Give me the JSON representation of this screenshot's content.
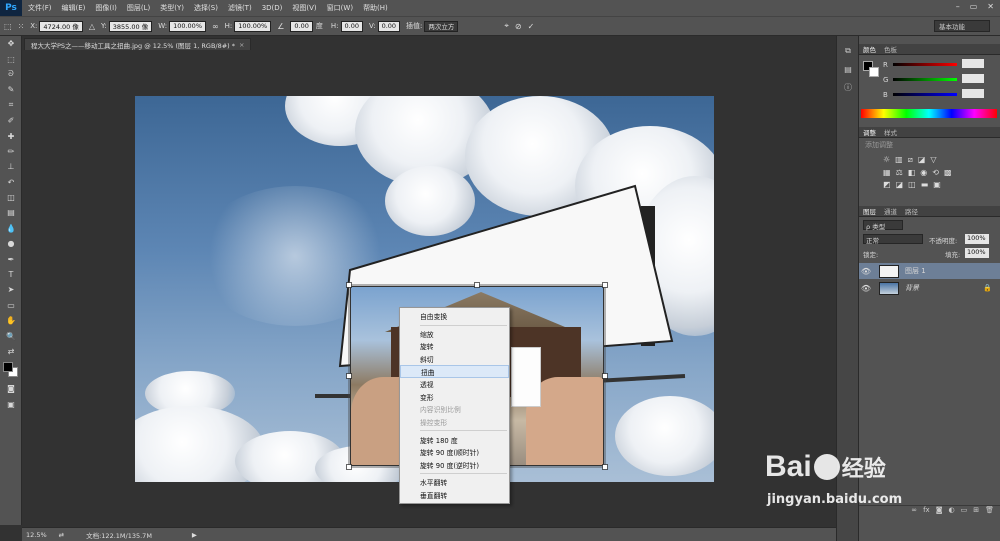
{
  "app": {
    "logo": "Ps"
  },
  "menus": [
    "文件(F)",
    "编辑(E)",
    "图像(I)",
    "图层(L)",
    "类型(Y)",
    "选择(S)",
    "滤镜(T)",
    "3D(D)",
    "视图(V)",
    "窗口(W)",
    "帮助(H)"
  ],
  "window_controls": {
    "minimize": "–",
    "restore": "▭",
    "close": "✕"
  },
  "options": {
    "x_label": "X:",
    "x_value": "4724.00 像",
    "y_label": "Y:",
    "y_value": "3855.00 像",
    "w_label": "W:",
    "w_value": "100.00%",
    "h_label": "H:",
    "h_value": "100.00%",
    "angle_value": "0.00",
    "angle_unit": "度",
    "hskew_label": "H:",
    "hskew_value": "0.00",
    "vskew_label": "V:",
    "vskew_value": "0.00",
    "interp_label": "插值:",
    "interp_value": "两次立方",
    "workspace": "基本功能"
  },
  "document_tab": {
    "title": "程大大学PS之——移动工具之扭曲.jpg @ 12.5% (图层 1, RGB/8#) *",
    "close": "×"
  },
  "context_menu": {
    "items": [
      {
        "label": "自由变换",
        "disabled": false
      },
      {
        "label": "缩放",
        "disabled": false
      },
      {
        "label": "旋转",
        "disabled": false
      },
      {
        "label": "斜切",
        "disabled": false
      },
      {
        "label": "扭曲",
        "disabled": false,
        "highlighted": true
      },
      {
        "label": "透视",
        "disabled": false
      },
      {
        "label": "变形",
        "disabled": false
      },
      {
        "label": "内容识别比例",
        "disabled": true
      },
      {
        "label": "操控变形",
        "disabled": true
      },
      {
        "label": "旋转 180 度",
        "disabled": false
      },
      {
        "label": "旋转 90 度(顺时针)",
        "disabled": false
      },
      {
        "label": "旋转 90 度(逆时针)",
        "disabled": false
      },
      {
        "label": "水平翻转",
        "disabled": false
      },
      {
        "label": "垂直翻转",
        "disabled": false
      }
    ]
  },
  "panels": {
    "color_tabs": [
      "颜色",
      "色板"
    ],
    "color_sliders": {
      "r": "R",
      "g": "G",
      "b": "B"
    },
    "adjust_tabs": [
      "调整",
      "样式"
    ],
    "adjust_hint": "添加调整",
    "layers_tabs": [
      "图层",
      "通道",
      "路径"
    ],
    "kind_label": "ρ 类型",
    "blend_mode": "正常",
    "opacity_label": "不透明度:",
    "opacity_value": "100%",
    "lock_label": "锁定:",
    "fill_label": "填充:",
    "fill_value": "100%",
    "layers": [
      {
        "name": "图层 1",
        "selected": true
      },
      {
        "name": "背景",
        "selected": false,
        "locked": true
      }
    ]
  },
  "status": {
    "zoom": "12.5%",
    "doc": "文档:122.1M/135.7M"
  },
  "watermark": {
    "brand": "Bai",
    "brand2": "经验",
    "url": "jingyan.baidu.com"
  },
  "colors": {
    "accent": "#31a8ff",
    "ui_bg": "#535353",
    "highlight": "#dce9f8"
  }
}
